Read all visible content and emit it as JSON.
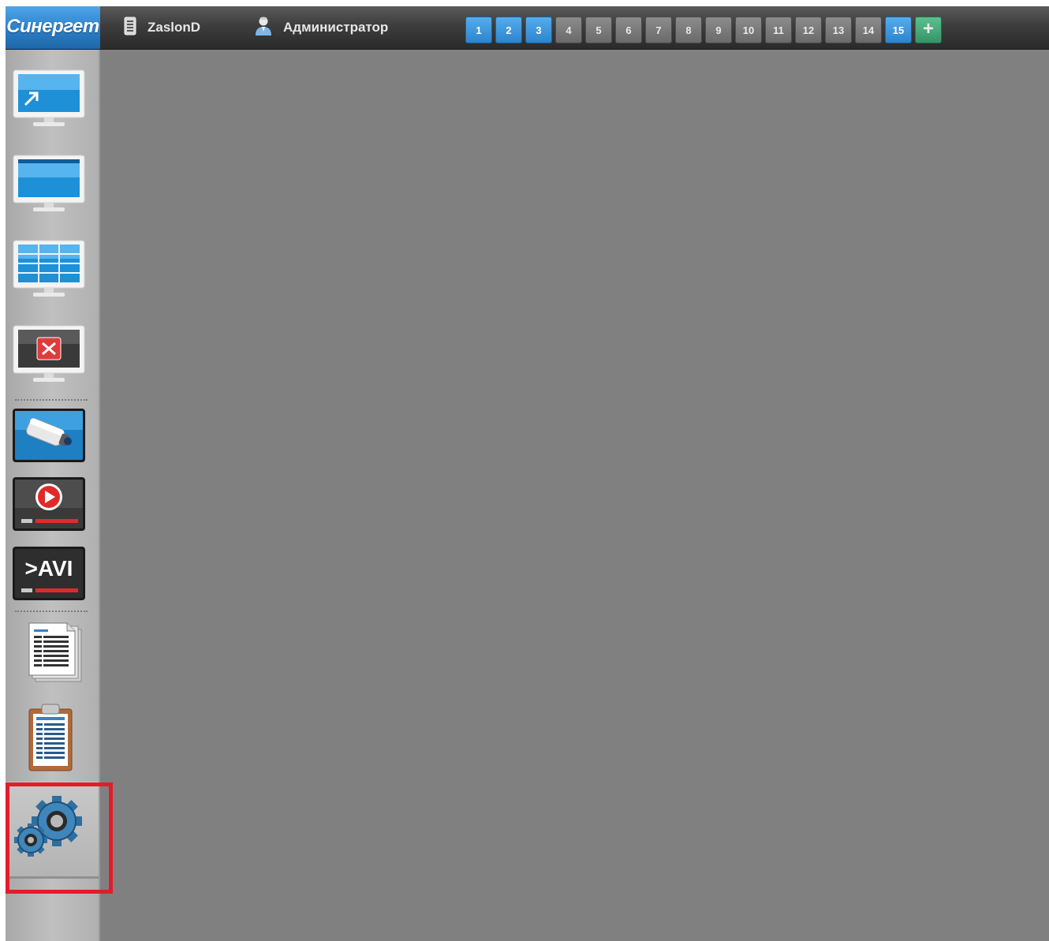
{
  "header": {
    "logo": "Синергет",
    "server_name": "ZaslonD",
    "user_name": "Администратор"
  },
  "layouts": {
    "tabs": [
      "1",
      "2",
      "3",
      "4",
      "5",
      "6",
      "7",
      "8",
      "9",
      "10",
      "11",
      "12",
      "13",
      "14",
      "15"
    ],
    "active_tabs": [
      "1",
      "2",
      "3",
      "15"
    ],
    "add_label": "+"
  },
  "sidebar": {
    "items": [
      {
        "icon": "monitor-fullscreen-icon"
      },
      {
        "icon": "monitor-single-icon"
      },
      {
        "icon": "monitor-grid-icon"
      },
      {
        "icon": "monitor-close-icon"
      },
      {
        "icon": "camera-icon"
      },
      {
        "icon": "playback-icon"
      },
      {
        "icon": "avi-export-icon",
        "text": ">AVI"
      },
      {
        "icon": "documents-icon"
      },
      {
        "icon": "clipboard-report-icon"
      },
      {
        "icon": "gears-settings-icon"
      }
    ]
  },
  "colors": {
    "accent_blue": "#2b84cf",
    "add_green": "#34946a",
    "highlight_red": "#e21d2b",
    "workspace": "#808080"
  }
}
